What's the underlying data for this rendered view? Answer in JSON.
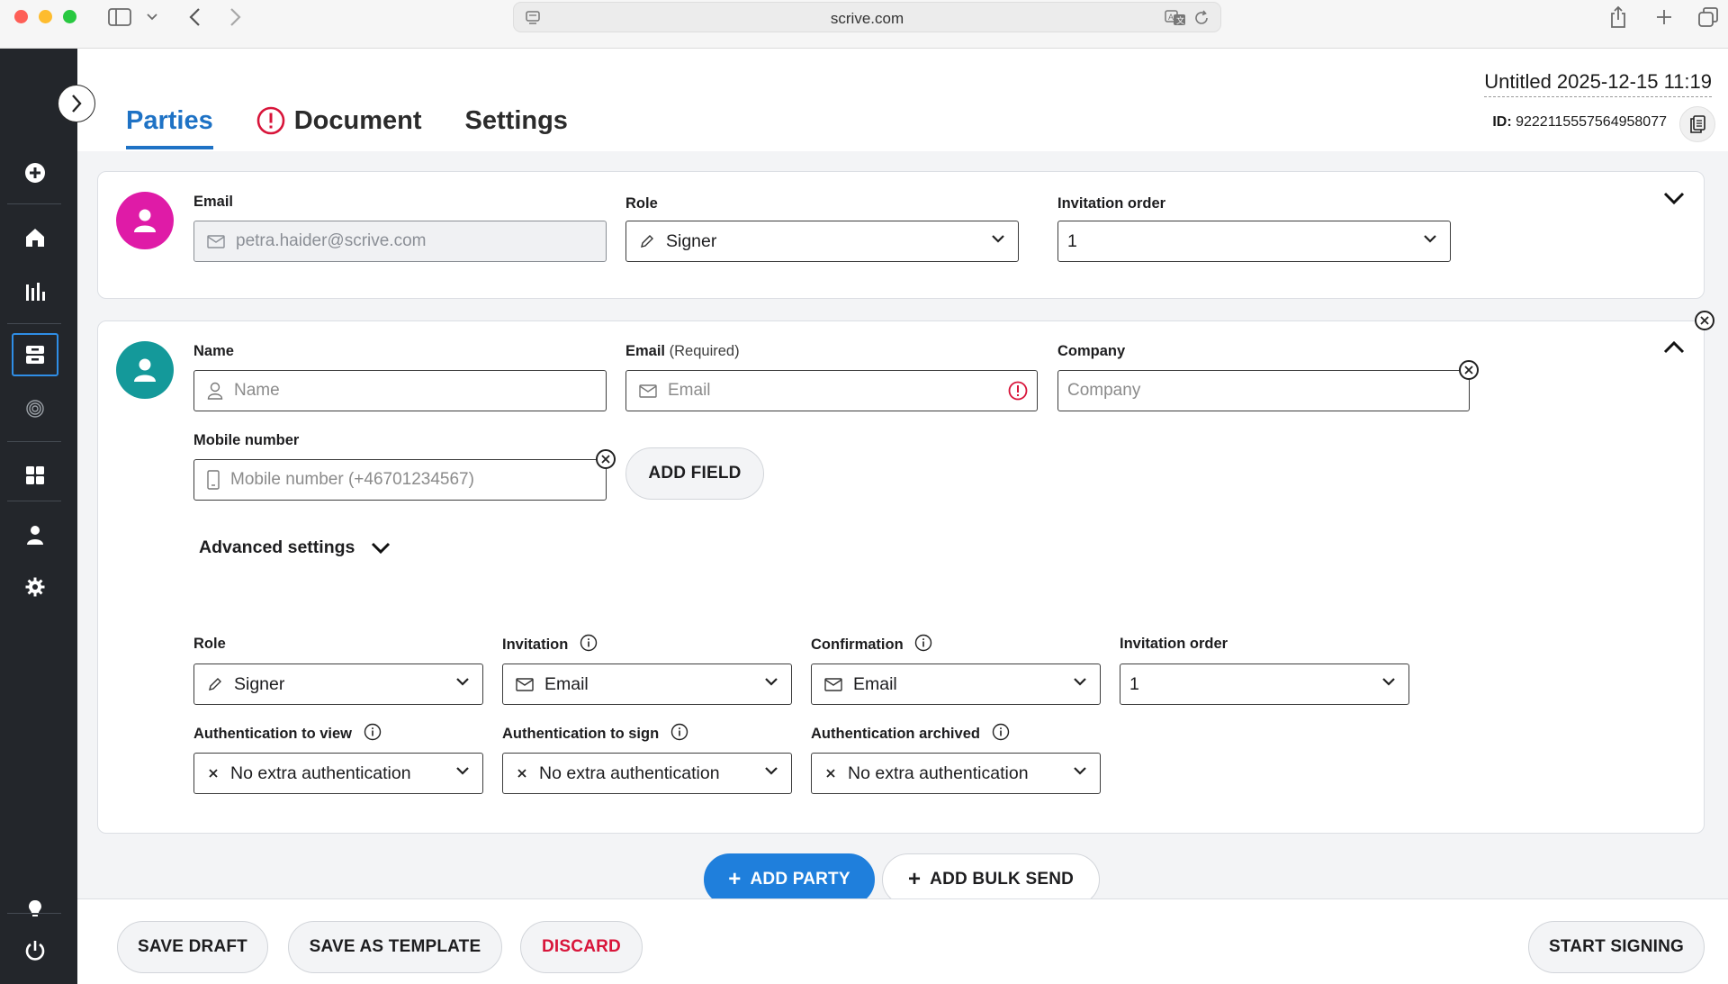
{
  "browser": {
    "url": "scrive.com"
  },
  "header": {
    "tabs": [
      {
        "label": "Parties",
        "active": true
      },
      {
        "label": "Document",
        "alert": true
      },
      {
        "label": "Settings"
      }
    ],
    "doc_title": "Untitled 2025-12-15 11:19",
    "doc_id_label": "ID:",
    "doc_id_value": "9222115557564958077"
  },
  "party1": {
    "email_label": "Email",
    "email_value": "petra.haider@scrive.com",
    "role_label": "Role",
    "role_value": "Signer",
    "order_label": "Invitation order",
    "order_value": "1"
  },
  "party2": {
    "name_label": "Name",
    "name_placeholder": "Name",
    "email_label": "Email",
    "email_required": "(Required)",
    "email_placeholder": "Email",
    "company_label": "Company",
    "company_placeholder": "Company",
    "mobile_label": "Mobile number",
    "mobile_placeholder": "Mobile number (+46701234567)",
    "add_field_label": "ADD FIELD",
    "advanced_label": "Advanced settings",
    "role_label": "Role",
    "role_value": "Signer",
    "invitation_label": "Invitation",
    "invitation_value": "Email",
    "confirmation_label": "Confirmation",
    "confirmation_value": "Email",
    "order_label": "Invitation order",
    "order_value": "1",
    "auth_view_label": "Authentication to view",
    "auth_view_value": "No extra authentication",
    "auth_sign_label": "Authentication to sign",
    "auth_sign_value": "No extra authentication",
    "auth_archived_label": "Authentication archived",
    "auth_archived_value": "No extra authentication"
  },
  "actions": {
    "add_party": "ADD PARTY",
    "add_bulk_send": "ADD BULK SEND"
  },
  "footer": {
    "save_draft": "SAVE DRAFT",
    "save_template": "SAVE AS TEMPLATE",
    "discard": "DISCARD",
    "start_signing": "START SIGNING"
  },
  "colors": {
    "accent": "#1e72c5",
    "primary_button": "#1f7fdc",
    "danger": "#d8153a",
    "avatar_party1": "#df1ba7",
    "avatar_party2": "#14999a",
    "sidebar": "#23262b"
  }
}
